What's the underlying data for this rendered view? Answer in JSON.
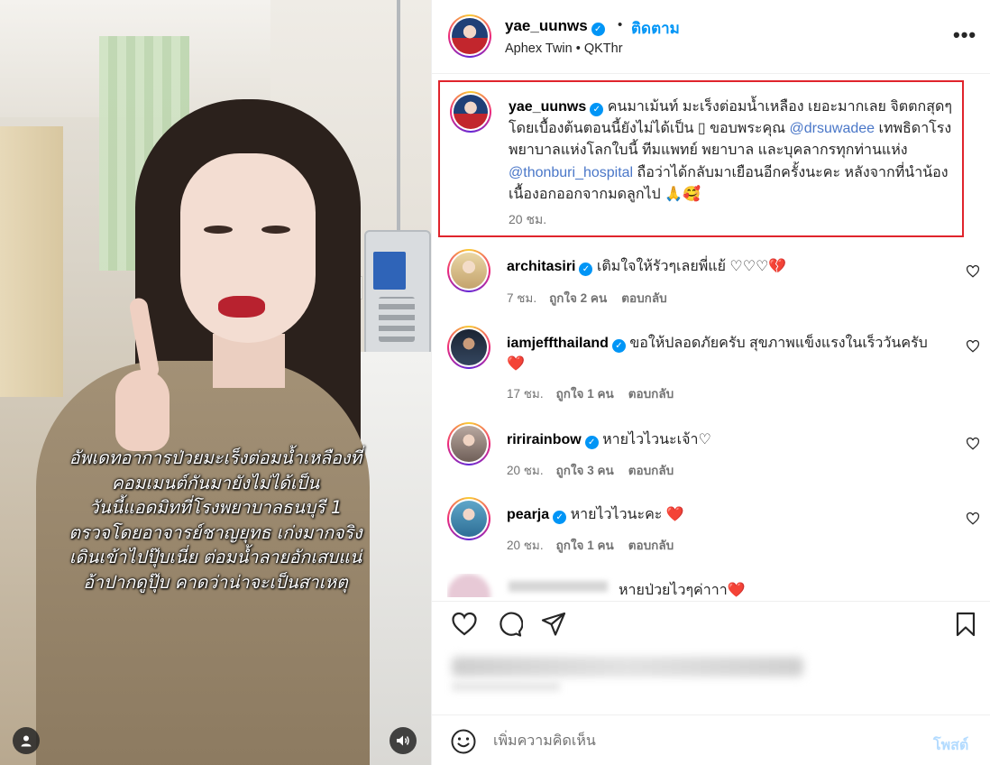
{
  "media": {
    "caption": "อัพเดทอาการป่วยมะเร็งต่อมน้ำเหลืองที่\nคอมเมนต์กันมายังไม่ได้เป็น\nวันนี้แอดมิทที่โรงพยาบาลธนบุรี 1\nตรวจโดยอาจารย์ชาญยุทธ เก่งมากจริง\nเดินเข้าไปปุ๊บเนี่ย ต่อมน้ำลายอักเสบแน่\nอ้าปากดูปุ๊บ คาดว่าน่าจะเป็นสาเหตุ",
    "user_tag_icon": "person-icon",
    "audio_icon": "speaker-icon"
  },
  "header": {
    "username": "yae_uunws",
    "verified_mark": "✓",
    "separator": "•",
    "follow_label": "ติดตาม",
    "subline": "Aphex Twin • QKThr",
    "more_label": "•••"
  },
  "caption": {
    "username": "yae_uunws",
    "text_1": " คนมาเม้นท์ มะเร็งต่อมน้ำเหลือง เยอะมากเลย จิตตกสุดๆ โดยเบื้องต้นตอนนี้ยังไม่ได้เป็น ▯ ขอบพระคุณ ",
    "mention_1": "@drsuwadee",
    "text_2": " เทพธิดาโรงพยาบาลแห่งโลกใบนี้ ทีมแพทย์ พยาบาล และบุคลากรทุกท่านแห่ง ",
    "mention_2": "@thonburi_hospital",
    "text_3": " ถือว่าได้กลับมาเยือนอีกครั้งนะคะ หลังจากที่นำน้องเนื้องอกออกจากมดลูกไป 🙏🥰",
    "time": "20 ชม."
  },
  "comments": [
    {
      "username": "architasiri",
      "text": " เติมใจให้รัวๆเลยพี่แย้ ♡♡♡💔",
      "time": "7 ชม.",
      "likes": "ถูกใจ 2 คน",
      "reply": "ตอบกลับ"
    },
    {
      "username": "iamjeffthailand",
      "text": " ขอให้ปลอดภัยครับ สุขภาพแข็งแรงในเร็ววันครับ ❤️",
      "time": "17 ชม.",
      "likes": "ถูกใจ 1 คน",
      "reply": "ตอบกลับ"
    },
    {
      "username": "ririrainbow",
      "text": " หายไวไวนะเจ้า♡",
      "time": "20 ชม.",
      "likes": "ถูกใจ 3 คน",
      "reply": "ตอบกลับ"
    },
    {
      "username": "pearja",
      "text": " หายไวไวนะคะ ❤️",
      "time": "20 ชม.",
      "likes": "ถูกใจ 1 คน",
      "reply": "ตอบกลับ"
    }
  ],
  "partial_comment": {
    "text": "หายป่วยไวๆค่าาา❤️"
  },
  "add_comment": {
    "placeholder": "เพิ่มความคิดเห็น",
    "post_label": "โพสต์"
  },
  "icons": {
    "like": "heart-icon",
    "comment": "comment-icon",
    "share": "share-icon",
    "save": "bookmark-icon",
    "emoji": "emoji-icon"
  },
  "colors": {
    "accent": "#0095f6",
    "highlight_border": "#e0242c",
    "mention": "#4a77c8",
    "muted": "#737373"
  }
}
